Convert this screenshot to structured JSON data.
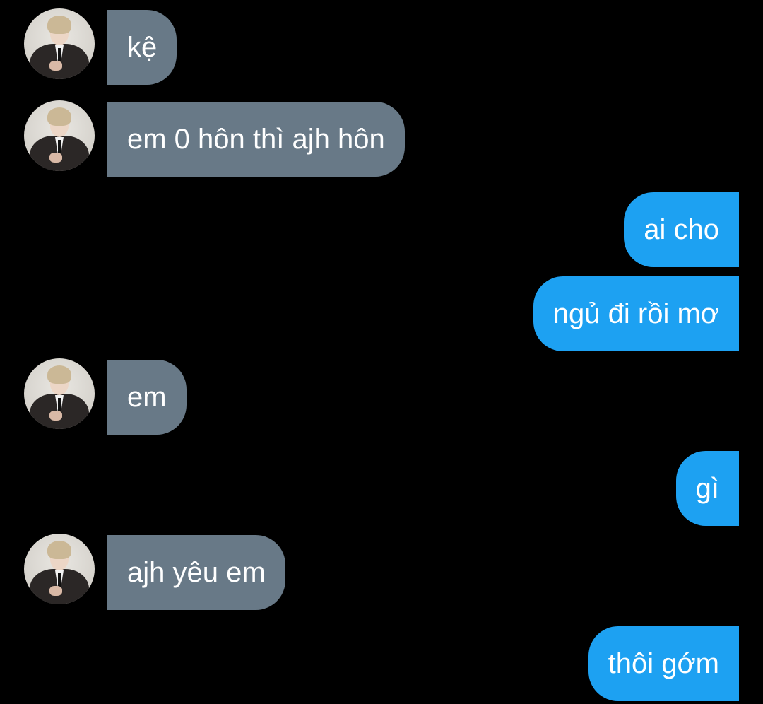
{
  "conversation": {
    "avatar_icon": "profile-photo-icon",
    "incoming_color": "#687987",
    "outgoing_color": "#1da1f2",
    "messages": [
      {
        "direction": "incoming",
        "text": "kệ"
      },
      {
        "direction": "incoming",
        "text": "em 0 hôn thì ajh hôn"
      },
      {
        "direction": "outgoing",
        "text": "ai cho"
      },
      {
        "direction": "outgoing",
        "text": "ngủ đi rồi mơ"
      },
      {
        "direction": "incoming",
        "text": "em"
      },
      {
        "direction": "outgoing",
        "text": "gì"
      },
      {
        "direction": "incoming",
        "text": "ajh yêu em"
      },
      {
        "direction": "outgoing",
        "text": "thôi gớm"
      }
    ]
  }
}
